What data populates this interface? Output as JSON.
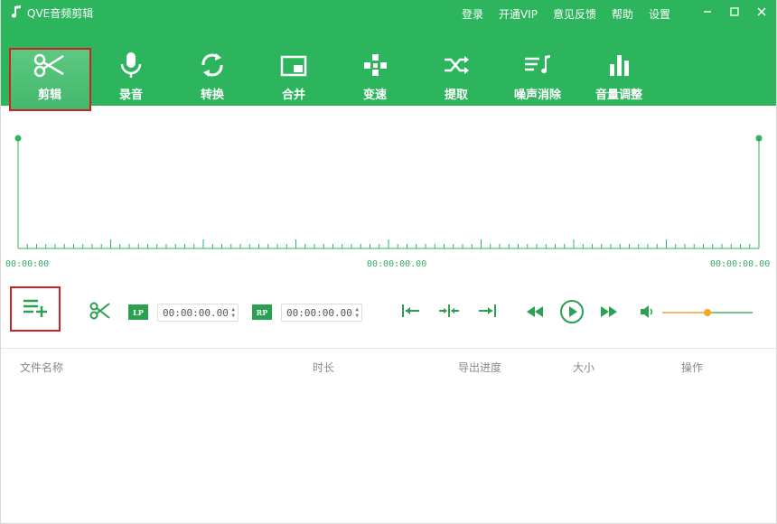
{
  "app": {
    "title": "QVE音频剪辑"
  },
  "top_links": [
    "登录",
    "开通VIP",
    "意见反馈",
    "帮助",
    "设置"
  ],
  "tools": [
    {
      "label": "剪辑",
      "icon": "scissors-icon"
    },
    {
      "label": "录音",
      "icon": "microphone-icon"
    },
    {
      "label": "转换",
      "icon": "convert-icon"
    },
    {
      "label": "合并",
      "icon": "merge-icon"
    },
    {
      "label": "变速",
      "icon": "speed-icon"
    },
    {
      "label": "提取",
      "icon": "extract-icon"
    },
    {
      "label": "噪声消除",
      "icon": "noise-removal-icon"
    },
    {
      "label": "音量调整",
      "icon": "volume-adjust-icon"
    }
  ],
  "timeline": {
    "start": "00:00:00",
    "middle": "00:00:00.00",
    "end": "00:00:00.00"
  },
  "controls": {
    "lp_label": "LP",
    "rp_label": "RP",
    "lp_time": "00:00:00.00",
    "rp_time": "00:00:00.00",
    "volume_level": 0.5
  },
  "table": {
    "columns": [
      "文件名称",
      "时长",
      "导出进度",
      "大小",
      "操作"
    ]
  },
  "colors": {
    "accent": "#2db55d",
    "highlight": "#cc2222",
    "volume": "#f5a623"
  }
}
